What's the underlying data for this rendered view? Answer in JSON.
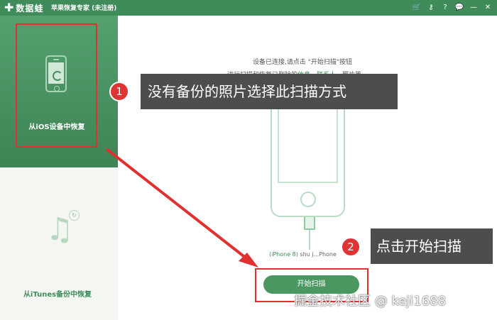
{
  "titlebar": {
    "logo_plus": "✚",
    "logo_text": "数据蛙",
    "app_title": "苹果恢复专家 (未注册)",
    "controls": [
      "cart-icon",
      "key-icon",
      "help-icon",
      "chat-icon",
      "minimize-icon",
      "close-icon"
    ],
    "control_glyphs": [
      "🛒",
      "⚷",
      "?",
      "💬",
      "—",
      "✕"
    ]
  },
  "sidebar": {
    "items": [
      {
        "label": "从iOS设备中恢复",
        "icon": "phone-sync-icon"
      },
      {
        "label": "从iTunes备份中恢复",
        "icon": "music-note-icon"
      }
    ],
    "music_glyph": "♫",
    "sync_glyph": "↻"
  },
  "main": {
    "instruction_line1": "设备已连接,请点击 \"开始扫描\"按钮",
    "instruction_line2_prefix": "进行扫描和恢复已删除的",
    "instruction_link1": "信息",
    "instruction_sep": "、",
    "instruction_link2": "联系人",
    "instruction_suffix": "、照片等。",
    "device_model": "(iPhone 8)",
    "device_name": " shu j...Phone",
    "scan_button": "开始扫描"
  },
  "annotations": {
    "step1_number": "1",
    "step1_text": "没有备份的照片选择此扫描方式",
    "step2_number": "2",
    "step2_text": "点击开始扫描"
  },
  "watermark": "掘金技术社区 @ keji1688",
  "colors": {
    "brand_green": "#3f8c5a",
    "annotation_red": "#e03030",
    "callout_bg": "#4d4d4d"
  }
}
